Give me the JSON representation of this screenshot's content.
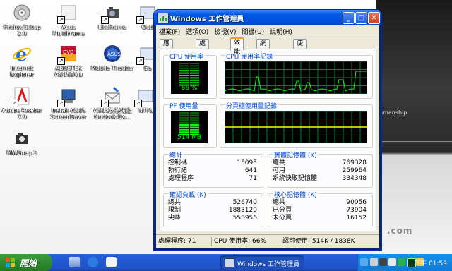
{
  "desktop_icons": [
    {
      "label": "Firefox Setup 2.0",
      "icon": "firefox-setup-icon"
    },
    {
      "label": "Asus MultiFrame",
      "icon": "shortcut-icon"
    },
    {
      "label": "LiteFrame",
      "icon": "camera-icon"
    },
    {
      "label": "Outl",
      "icon": "shortcut-icon"
    },
    {
      "label": "Internet Explorer",
      "icon": "internet-explorer-icon"
    },
    {
      "label": "ASUSTEK ASUSDVD",
      "icon": "dvd-icon"
    },
    {
      "label": "Mobile Theater",
      "icon": "mobile-theater-icon"
    },
    {
      "label": "Ea",
      "icon": "shortcut-icon"
    },
    {
      "label": "Adobe Reader 7.0",
      "icon": "adobe-reader-icon"
    },
    {
      "label": "Install ASUS ScreenSaver",
      "icon": "installer-icon"
    },
    {
      "label": "ASUS安裝功能 Outlook Ex...",
      "icon": "outlook-express-icon"
    },
    {
      "label": "NTFS",
      "icon": "shortcut-icon"
    },
    {
      "label": "MWSnap 3",
      "icon": "camera-icon"
    }
  ],
  "wallpaper": {
    "text": "nmanship",
    "url": ".com"
  },
  "window": {
    "title": "Windows 工作管理員",
    "menu": [
      "檔案(F)",
      "選項(O)",
      "檢視(V)",
      "關機(U)",
      "說明(H)"
    ],
    "tabs": [
      "應用程式",
      "處理程序",
      "效能",
      "網路功能",
      "使用者"
    ],
    "active_tab": "效能",
    "cpu_usage": {
      "title": "CPU 使用率",
      "value": "66 %",
      "fraction": 0.66
    },
    "cpu_history": {
      "title": "CPU 使用率記錄"
    },
    "pf_usage": {
      "title": "PF 使用量",
      "value": "514 MB",
      "fraction": 0.5
    },
    "pf_history": {
      "title": "分頁檔使用量記錄"
    },
    "totals": {
      "title": "總計",
      "rows": [
        [
          "控制碼",
          "15095"
        ],
        [
          "執行緒",
          "641"
        ],
        [
          "處理程序",
          "71"
        ]
      ]
    },
    "physical": {
      "title": "實體記憶體 (K)",
      "rows": [
        [
          "總共",
          "769328"
        ],
        [
          "可用",
          "259964"
        ],
        [
          "系統快取記憶體",
          "334348"
        ]
      ]
    },
    "commit": {
      "title": "確認負載 (K)",
      "rows": [
        [
          "總共",
          "526740"
        ],
        [
          "限制",
          "1883120"
        ],
        [
          "尖峰",
          "550956"
        ]
      ]
    },
    "kernel": {
      "title": "核心記憶體 (K)",
      "rows": [
        [
          "總共",
          "90056"
        ],
        [
          "已分頁",
          "73904"
        ],
        [
          "未分頁",
          "16152"
        ]
      ]
    },
    "status": {
      "processes": "處理程序: 71",
      "cpu": "CPU 使用率: 66%",
      "commit": "認可使用: 514K / 1838K"
    }
  },
  "taskbar": {
    "start": "開始",
    "task_button": "Windows 工作管理員",
    "clock": "下午 01:59"
  }
}
